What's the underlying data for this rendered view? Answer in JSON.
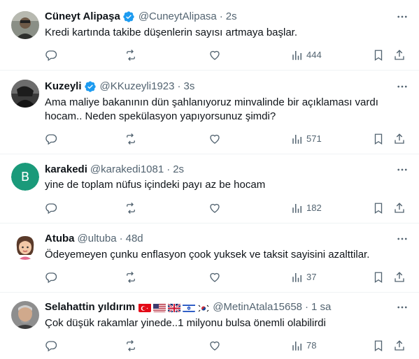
{
  "tweets": [
    {
      "name": "Cüneyt Alipaşa",
      "verified": true,
      "handle": "@CuneytAlipasa",
      "time": "2s",
      "text": "Kredi kartında takibe düşenlerin sayısı artmaya başlar.",
      "views": "444",
      "avatar": "photo"
    },
    {
      "name": "Kuzeyli",
      "verified": true,
      "handle": "@KKuzeyli1923",
      "time": "3s",
      "text": "Ama maliye bakanının dün şahlanıyoruz minvalinde bir açıklaması vardı hocam.. Neden spekülasyon yapıyorsunuz şimdi?",
      "views": "571",
      "avatar": "photo"
    },
    {
      "name": "karakedi",
      "verified": false,
      "handle": "@karakedi1081",
      "time": "2s",
      "text": "yine de toplam nüfus içindeki payı az be hocam",
      "views": "182",
      "avatar": "letter",
      "avatar_letter": "B",
      "avatar_color": "#1a9a7a"
    },
    {
      "name": "Atuba",
      "verified": false,
      "handle": "@ultuba",
      "time": "48d",
      "text": "Ödeyemeyen çunku enflasyon çook yuksek ve taksit sayisini azalttilar.",
      "views": "37",
      "avatar": "memoji"
    },
    {
      "name": "Selahattin yıldırım",
      "verified": false,
      "flags": [
        "turkey-flag",
        "usa-flag",
        "uk-flag",
        "israel-flag",
        "south-korea-flag"
      ],
      "handle": "@MetinAtala15658",
      "time": "1 sa",
      "text": "Çok düşük rakamlar yinede..1 milyonu bulsa önemli olabilirdi",
      "views": "78",
      "avatar": "photo"
    }
  ],
  "separator": "·",
  "colors": {
    "text": "#0f1419",
    "secondary": "#536471",
    "verified": "#1d9bf0",
    "border": "#eff3f4"
  },
  "icons": [
    "reply-icon",
    "retweet-icon",
    "like-icon",
    "views-icon",
    "bookmark-icon",
    "share-icon",
    "more-icon",
    "verified-badge-icon"
  ]
}
